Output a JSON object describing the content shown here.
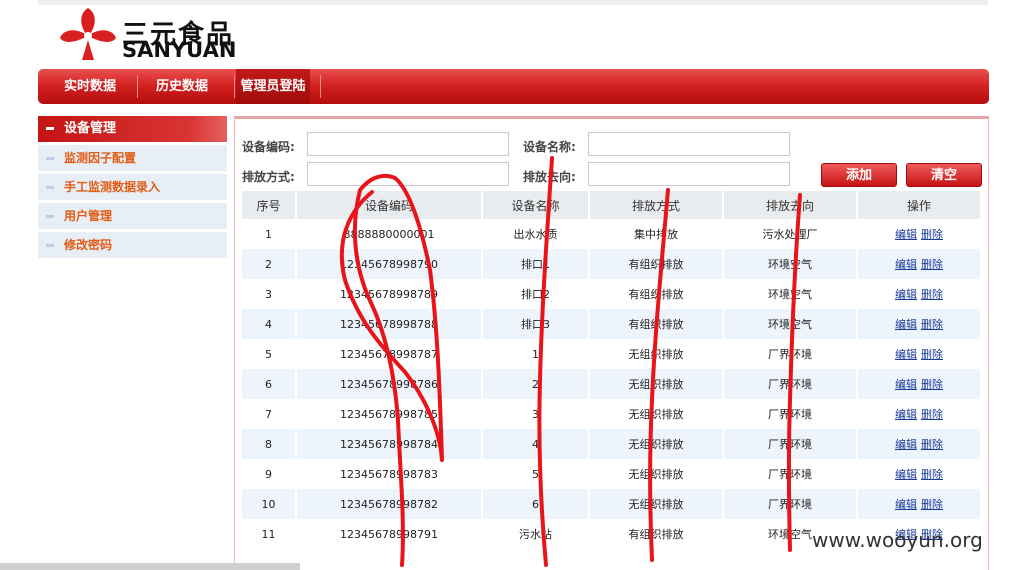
{
  "brand": {
    "cn": "三元食品",
    "en": "SANYUAN",
    "color": "#d91f1f"
  },
  "nav": {
    "items": [
      {
        "label": "实时数据"
      },
      {
        "label": "历史数据"
      },
      {
        "label": "管理员登陆"
      }
    ],
    "active_index": 2
  },
  "sidebar": {
    "header": "设备管理",
    "items": [
      {
        "label": "监测因子配置"
      },
      {
        "label": "手工监测数据录入"
      },
      {
        "label": "用户管理"
      },
      {
        "label": "修改密码"
      }
    ]
  },
  "form": {
    "device_code_label": "设备编码:",
    "device_code_value": "",
    "device_name_label": "设备名称:",
    "device_name_value": "",
    "discharge_mode_label": "排放方式:",
    "discharge_mode_value": "",
    "discharge_dest_label": "排放去向:",
    "discharge_dest_value": "",
    "add_button": "添加",
    "clear_button": "清空"
  },
  "table": {
    "columns": [
      "序号",
      "设备编码",
      "设备名称",
      "排放方式",
      "排放去向",
      "操作"
    ],
    "edit_label": "编辑",
    "delete_label": "删除",
    "rows": [
      {
        "no": "1",
        "code": "8888880000001",
        "name": "出水水质",
        "mode": "集中排放",
        "dest": "污水处理厂"
      },
      {
        "no": "2",
        "code": "12345678998790",
        "name": "排口1",
        "mode": "有组织排放",
        "dest": "环境空气"
      },
      {
        "no": "3",
        "code": "12345678998789",
        "name": "排口2",
        "mode": "有组织排放",
        "dest": "环境空气"
      },
      {
        "no": "4",
        "code": "12345678998788",
        "name": "排口3",
        "mode": "有组织排放",
        "dest": "环境空气"
      },
      {
        "no": "5",
        "code": "12345678998787",
        "name": "1",
        "mode": "无组织排放",
        "dest": "厂界环境"
      },
      {
        "no": "6",
        "code": "12345678998786",
        "name": "2",
        "mode": "无组织排放",
        "dest": "厂界环境"
      },
      {
        "no": "7",
        "code": "12345678998785",
        "name": "3",
        "mode": "无组织排放",
        "dest": "厂界环境"
      },
      {
        "no": "8",
        "code": "12345678998784",
        "name": "4",
        "mode": "无组织排放",
        "dest": "厂界环境"
      },
      {
        "no": "9",
        "code": "12345678998783",
        "name": "5",
        "mode": "无组织排放",
        "dest": "厂界环境"
      },
      {
        "no": "10",
        "code": "12345678998782",
        "name": "6",
        "mode": "无组织排放",
        "dest": "厂界环境"
      },
      {
        "no": "11",
        "code": "12345678998791",
        "name": "污水站",
        "mode": "有组织排放",
        "dest": "环境空气"
      }
    ]
  },
  "watermark": "www.wooyun.org",
  "colors": {
    "nav_red": "#d21f1f",
    "sidebar_text": "#e45b14",
    "link": "#1a3a9a",
    "scribble": "#e8141a"
  }
}
